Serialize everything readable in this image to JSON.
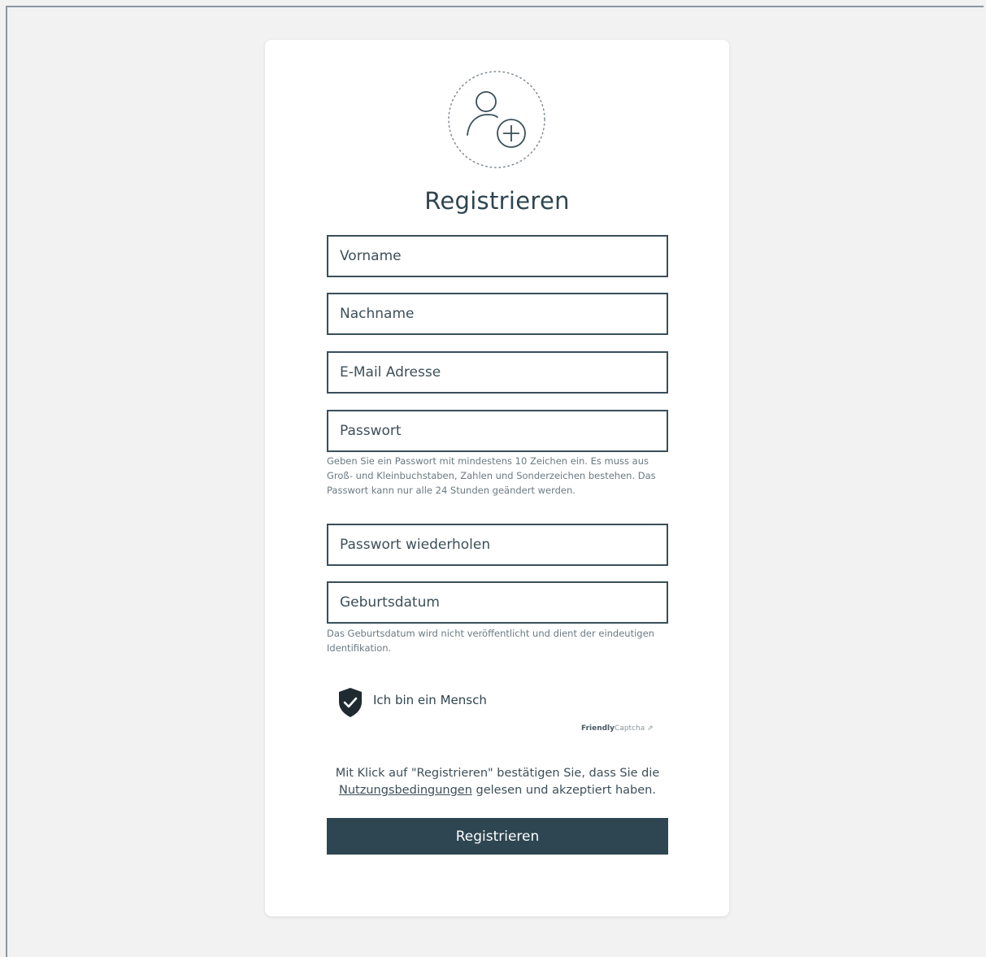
{
  "title": "Registrieren",
  "fields": {
    "vorname": {
      "placeholder": "Vorname",
      "value": ""
    },
    "nachname": {
      "placeholder": "Nachname",
      "value": ""
    },
    "email": {
      "placeholder": "E-Mail Adresse",
      "value": ""
    },
    "passwort": {
      "placeholder": "Passwort",
      "value": ""
    },
    "passwort_wiederholen": {
      "placeholder": "Passwort wiederholen",
      "value": ""
    },
    "geburtsdatum": {
      "placeholder": "Geburtsdatum",
      "value": ""
    }
  },
  "hints": {
    "passwort": "Geben Sie ein Passwort mit mindestens 10 Zeichen ein. Es muss aus Groß- und Kleinbuchstaben, Zahlen und Sonderzeichen bestehen. Das Passwort kann nur alle 24 Stunden geändert werden.",
    "geburtsdatum": "Das Geburtsdatum wird nicht veröffentlicht und dient der eindeutigen Identifikation."
  },
  "captcha": {
    "label": "Ich bin ein Mensch",
    "brand_strong": "Friendly",
    "brand_light": "Captcha",
    "brand_arrow": "⇗",
    "icon": "shield-check-icon"
  },
  "terms": {
    "text_before": "Mit Klick auf \"Registrieren\" bestätigen Sie, dass Sie die",
    "link": "Nutzungsbedingungen",
    "text_after": "gelesen und akzeptiert haben."
  },
  "submit_label": "Registrieren",
  "icons": {
    "avatar": "add-user-icon"
  },
  "colors": {
    "primary": "#2d4651",
    "text": "#2f4550",
    "background": "#f2f2f2",
    "card": "#ffffff"
  }
}
